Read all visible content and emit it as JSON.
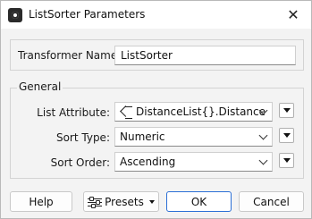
{
  "window": {
    "title": "ListSorter Parameters",
    "close_symbol": "✕"
  },
  "transformer_name": {
    "label": "Transformer Name:",
    "value": "ListSorter"
  },
  "general": {
    "group_label": "General",
    "list_attribute": {
      "label": "List Attribute:",
      "value": "DistanceList{}.Distance",
      "icon": "attribute-icon"
    },
    "sort_type": {
      "label": "Sort Type:",
      "value": "Numeric"
    },
    "sort_order": {
      "label": "Sort Order:",
      "value": "Ascending"
    }
  },
  "buttons": {
    "help": "Help",
    "presets": "Presets",
    "ok": "OK",
    "cancel": "Cancel"
  },
  "colors": {
    "accent": "#2b6fd6"
  }
}
